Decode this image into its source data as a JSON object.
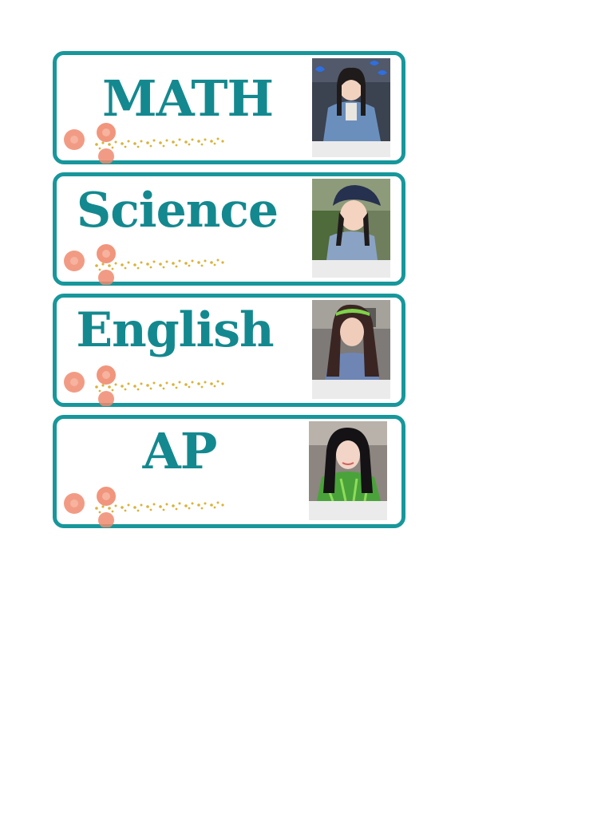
{
  "labels": [
    {
      "title": "MATH",
      "photo_icon": "portrait-photo-icon",
      "flower_icon": "peach-flower-icon"
    },
    {
      "title": "Science",
      "photo_icon": "portrait-photo-icon",
      "flower_icon": "peach-flower-icon"
    },
    {
      "title": "English",
      "photo_icon": "portrait-photo-icon",
      "flower_icon": "peach-flower-icon"
    },
    {
      "title": "AP",
      "photo_icon": "portrait-photo-icon",
      "flower_icon": "peach-flower-icon"
    }
  ],
  "colors": {
    "border": "#17979b",
    "title": "#13898f",
    "flower": "#f08a6e",
    "dots": "#d9b33a"
  }
}
